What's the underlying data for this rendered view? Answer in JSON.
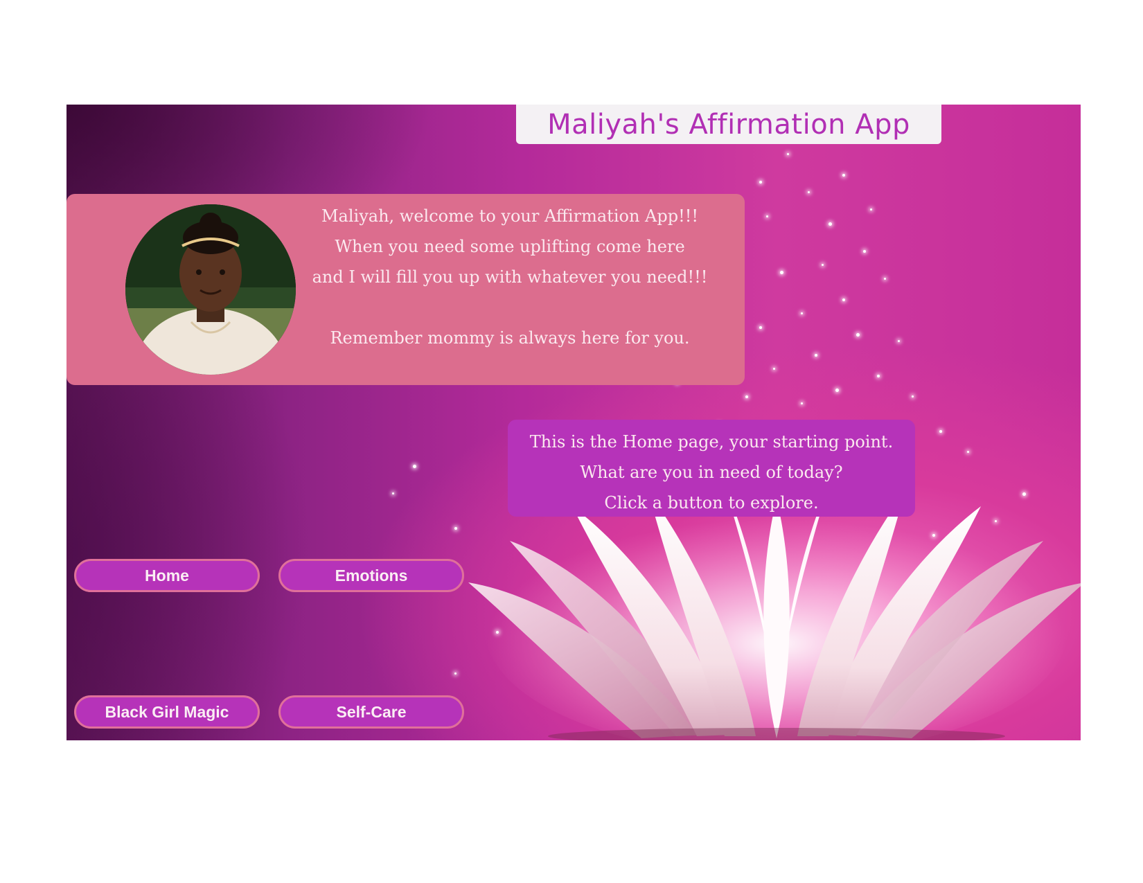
{
  "app": {
    "title": "Maliyah's Affirmation App"
  },
  "welcome": {
    "lines": [
      "Maliyah, welcome to your Affirmation App!!!",
      "When you need some uplifting come here",
      "and I will fill you up with whatever you need!!!",
      "",
      "Remember mommy is always here for you."
    ]
  },
  "home_message": {
    "lines": [
      "This is the Home page, your starting point.",
      "What are you in need of today?",
      "Click a button to explore."
    ]
  },
  "nav": {
    "home": "Home",
    "emotions": "Emotions",
    "black_girl_magic": "Black Girl Magic",
    "self_care": "Self-Care"
  },
  "colors": {
    "title": "#b12fb4",
    "welcome_panel": "#dc6d8e",
    "home_panel": "#b633b9",
    "button_fill": "#b633b9",
    "button_border": "#e0709a"
  },
  "icons": {
    "avatar": "child-portrait-photo",
    "background": "lotus-flower-sparkles"
  }
}
